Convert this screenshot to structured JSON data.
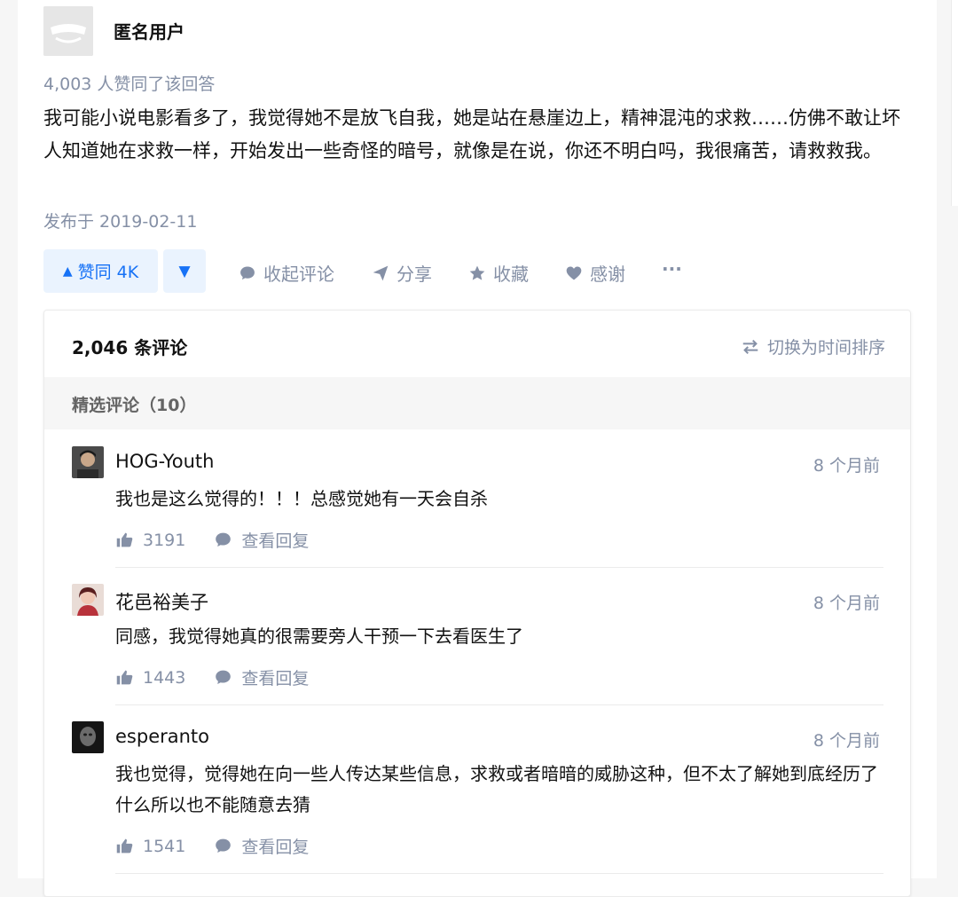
{
  "answer": {
    "author": "匿名用户",
    "vote_summary": "4,003 人赞同了该回答",
    "content": "我可能小说电影看多了，我觉得她不是放飞自我，她是站在悬崖边上，精神混沌的求救……仿佛不敢让坏人知道她在求救一样，开始发出一些奇怪的暗号，就像是在说，你还不明白吗，我很痛苦，请救救我。",
    "published": "发布于 2019-02-11"
  },
  "actions": {
    "upvote_label": "赞同 4K",
    "collapse_comments": "收起评论",
    "share": "分享",
    "favorite": "收藏",
    "thanks": "感谢",
    "more": "···"
  },
  "comments": {
    "count_label": "2,046 条评论",
    "sort_toggle": "切换为时间排序",
    "featured_label": "精选评论（10）",
    "items": [
      {
        "author": "HOG-Youth",
        "time": "8 个月前",
        "text": "我也是这么觉得的！！！总感觉她有一天会自杀",
        "likes": "3191",
        "reply_label": "查看回复"
      },
      {
        "author": "花邑裕美子",
        "time": "8 个月前",
        "text": "同感，我觉得她真的很需要旁人干预一下去看医生了",
        "likes": "1443",
        "reply_label": "查看回复"
      },
      {
        "author": "esperanto",
        "time": "8 个月前",
        "text": "我也觉得，觉得她在向一些人传达某些信息，求救或者暗暗的威胁这种，但不太了解她到底经历了什么所以也不能随意去猜",
        "likes": "1541",
        "reply_label": "查看回复"
      }
    ]
  },
  "colors": {
    "accent_blue": "#1772f6",
    "upvote_bg": "#eaf3fe",
    "meta_gray": "#8590a6",
    "text": "#121212"
  },
  "icons": [
    "triangle-up-icon",
    "triangle-down-icon",
    "comment-bubble-icon",
    "paper-plane-icon",
    "star-icon",
    "heart-icon",
    "swap-arrows-icon",
    "thumbs-up-icon"
  ]
}
